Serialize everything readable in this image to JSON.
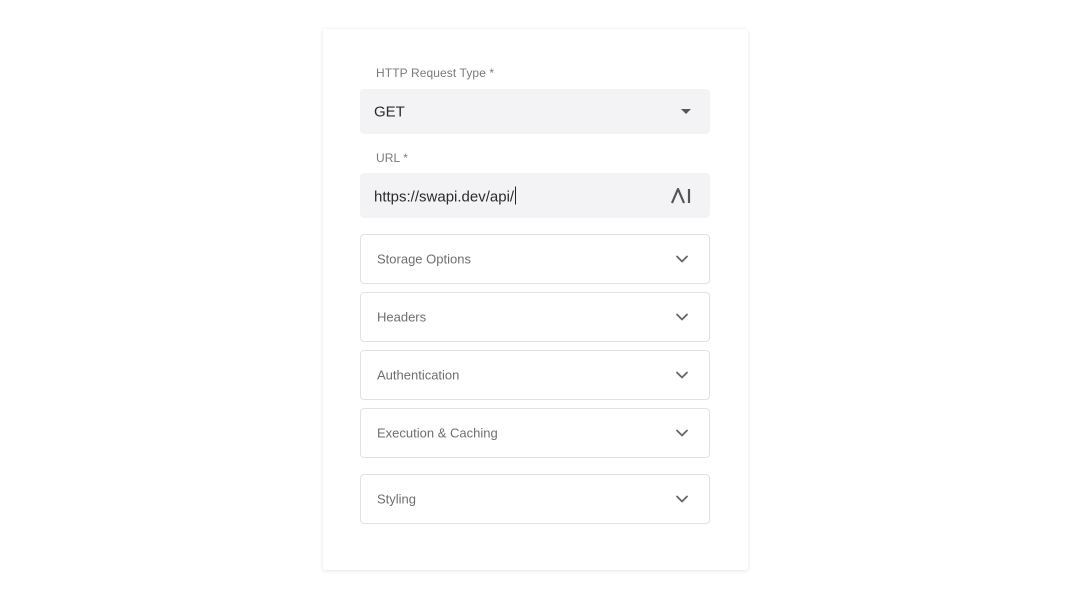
{
  "form": {
    "http_type": {
      "label": "HTTP Request Type *",
      "value": "GET",
      "icon": "caret-down-icon"
    },
    "url": {
      "label": "URL *",
      "value": "https://swapi.dev/api/",
      "ai_icon_label": "AI",
      "icon": "ai-icon"
    },
    "sections": [
      {
        "label": "Storage Options",
        "icon": "chevron-down-icon"
      },
      {
        "label": "Headers",
        "icon": "chevron-down-icon"
      },
      {
        "label": "Authentication",
        "icon": "chevron-down-icon"
      },
      {
        "label": "Execution & Caching",
        "icon": "chevron-down-icon"
      },
      {
        "label": "Styling",
        "icon": "chevron-down-icon"
      }
    ]
  },
  "colors": {
    "background": "#ffffff",
    "field_fill": "#f3f3f5",
    "border": "#e2e2e2",
    "label_text": "#7a7a7a",
    "value_text": "#2b2b2b"
  }
}
